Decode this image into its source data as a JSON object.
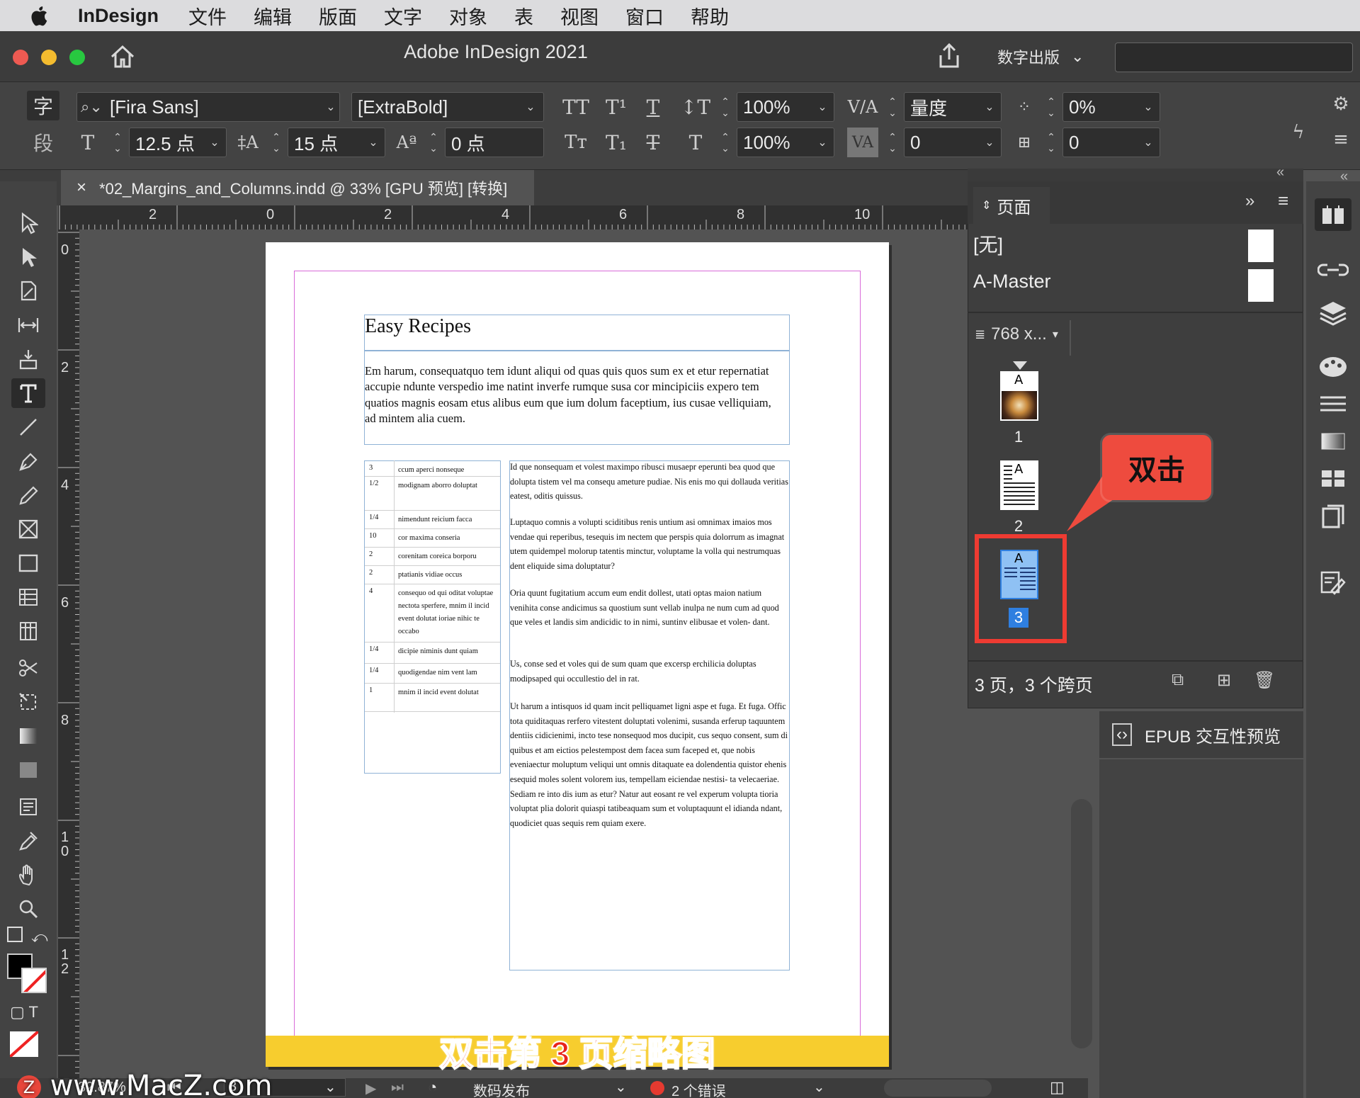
{
  "menubar": {
    "app": "InDesign",
    "items": [
      "文件",
      "编辑",
      "版面",
      "文字",
      "对象",
      "表",
      "视图",
      "窗口",
      "帮助"
    ]
  },
  "titlebar": {
    "title": "Adobe InDesign 2021",
    "workspace": "数字出版"
  },
  "control": {
    "char_tab": "字",
    "para_tab": "段",
    "font_family": "[Fira Sans]",
    "font_style": "[ExtraBold]",
    "font_size": "12.5 点",
    "leading": "15 点",
    "baseline_shift": "0 点",
    "vertical_scale": "100%",
    "horizontal_scale": "100%",
    "kerning": "量度",
    "tracking": "0",
    "tsume": "0%",
    "grid": "0"
  },
  "document": {
    "tab_label": "*02_Margins_and_Columns.indd @ 33% [GPU 预览] [转换]",
    "hruler_ticks": [
      "2",
      "0",
      "2",
      "4",
      "6",
      "8",
      "10"
    ],
    "vruler_ticks": [
      "0",
      "2",
      "4",
      "6",
      "8",
      "1\n0",
      "1\n2"
    ],
    "heading": "Easy Recipes",
    "intro": "Em harum, consequatquo tem idunt aliqui od quas quis quos sum ex et etur repernatiat accupie ndunte verspedio ime natint inverfe rumque susa cor mincipiciis expero tem quatios magnis eosam etus alibus eum que ium dolum faceptium, ius cusae velliquiam, ad mintem alia cuem.",
    "table_rows": [
      {
        "qty": "3",
        "name": "ccum aperci nonseque"
      },
      {
        "qty": "1/2",
        "name": "modignam aborro doluptat"
      },
      {
        "qty": "1/4",
        "name": "nimendunt reicium facca"
      },
      {
        "qty": "10",
        "name": "cor maxima conseria"
      },
      {
        "qty": "2",
        "name": "corenitam coreica borporu"
      },
      {
        "qty": "2",
        "name": "ptatianis vidiae occus"
      },
      {
        "qty": "4",
        "name": "consequo od qui oditat voluptae nectota sperfere, mnim il incid event dolutat ioriae nihic te occabo"
      },
      {
        "qty": "1/4",
        "name": "dicipie niminis dunt quiam"
      },
      {
        "qty": "1/4",
        "name": "quodigendae nim vent lam"
      },
      {
        "qty": "1",
        "name": "mnim il incid event dolutat"
      }
    ],
    "body_paragraphs": [
      "Id que nonsequam et volest maximpo ribusci musaepr eperunti bea quod que dolupta tistem vel ma consequ ameture pudiae. Nis enis mo qui dollauda veritias eatest, oditis quissus.",
      "Luptaquo comnis a volupti sciditibus renis untium asi omnimax imaios mos vendae qui reperibus, tesequis im nectem que perspis quia dolorrum as imagnat utem quidempel molorup tatentis minctur, voluptame la volla qui nestrumquas dent eliquide sima doluptatur?",
      "Oria quunt fugitatium accum eum endit dollest, utati optas maion natium venihita conse andicimus sa quostium sunt vellab inulpa ne num cum ad quod que veles et landis sim andicidic to in nimi, suntinv elibusae et volen- dant.",
      "Us, conse sed et voles qui de sum quam que excersp erchilicia doluptas modipsaped qui occullestio del in rat.",
      "Ut harum a intisquos id quam incit pelliquamet ligni aspe et fuga. Et fuga. Offic tota quiditaquas rerfero vitestent doluptati volenimi, susanda erferup taquuntem dentiis cidicienimi, incto tese nonsequod mos ducipit, cus sequo consent, sum di quibus et am eictios pelestempost dem facea sum faceped et, que nobis eveniaectur moluptum veliqui unt omnis ditaquate ea dolendentia quistor ehenis esequid moles solent volorem ius, tempellam eiciendae nestisi- ta velecaeriae. Sediam re into dis ium as etur? Natur aut eosant re vel experum volupta tioria voluptat plia dolorit quiaspi tatibeaquam sum et voluptaquunt el idianda ndant, quodiciet quas sequis rem quiam exere."
    ],
    "subtitle": "双击第 3 页缩略图"
  },
  "pages_panel": {
    "title": "页面",
    "masters": [
      "[无]",
      "A-Master"
    ],
    "size_label": "768 x...",
    "thumbs": [
      "1",
      "2",
      "3"
    ],
    "summary": "3 页，3 个跨页",
    "callout": "双击"
  },
  "epub_panel": {
    "label": "EPUB 交互性预览"
  },
  "status": {
    "zoom": "32.87%",
    "page": "3",
    "profile": "数码发布",
    "errors": "2 个错误"
  },
  "watermark": "www.MacZ.com",
  "colors": {
    "accent_red": "#ee3b32",
    "selection_blue": "#2f7fe0",
    "subtitle_yellow": "#f7cd2e",
    "margin_magenta": "#d96ad9"
  }
}
